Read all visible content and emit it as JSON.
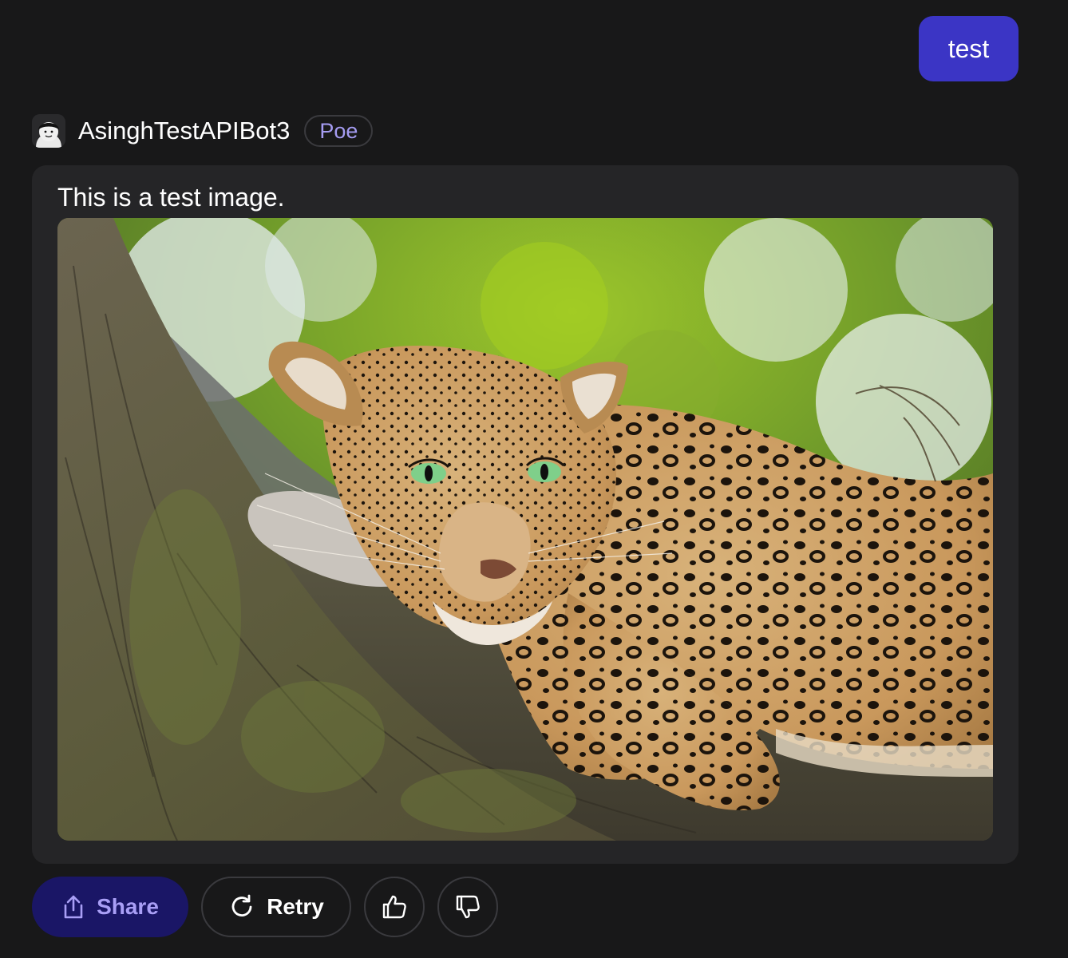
{
  "user_message": {
    "text": "test"
  },
  "bot": {
    "name": "AsinghTestAPIBot3",
    "badge": "Poe",
    "avatar_icon": "cartoon-face-icon"
  },
  "bot_message": {
    "text": "This is a test image.",
    "image_subject": "leopard-resting-on-tree-branch"
  },
  "actions": {
    "share_label": "Share",
    "retry_label": "Retry",
    "like_icon": "thumbs-up-icon",
    "dislike_icon": "thumbs-down-icon"
  },
  "colors": {
    "background": "#181819",
    "user_bubble": "#3b35c5",
    "card": "#252527",
    "badge_text": "#a59cf2",
    "share_bg": "#1a1666",
    "share_text": "#a99ff6"
  }
}
